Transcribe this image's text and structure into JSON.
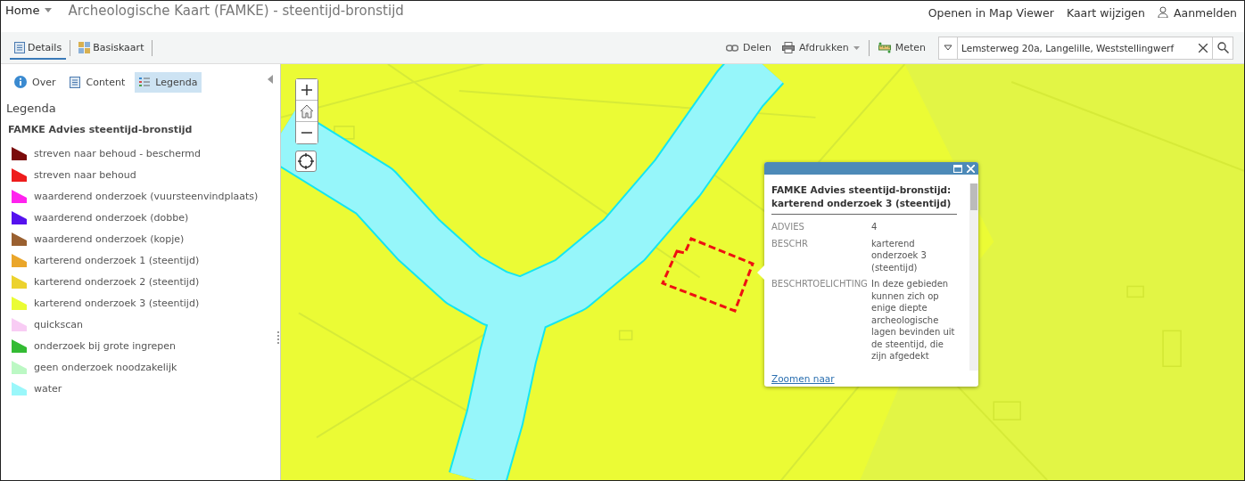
{
  "header": {
    "home": "Home",
    "title": "Archeologische Kaart (FAMKE) - steentijd-bronstijd",
    "links": [
      "Openen in Map Viewer",
      "Kaart wijzigen"
    ],
    "sign_in": "Aanmelden"
  },
  "toolbar": {
    "tabs": [
      {
        "label": "Details",
        "selected": true
      },
      {
        "label": "Basiskaart",
        "selected": false
      }
    ],
    "actions": [
      {
        "kind": "share",
        "label": "Delen"
      },
      {
        "kind": "print",
        "label": "Afdrukken"
      },
      {
        "kind": "measure",
        "label": "Meten"
      }
    ],
    "search": {
      "value": "Lemsterweg 20a, Langelille, Weststellingwerf"
    }
  },
  "panel": {
    "tabs": [
      {
        "kind": "info",
        "label": "Over",
        "selected": false
      },
      {
        "kind": "content",
        "label": "Content",
        "selected": false
      },
      {
        "kind": "legend",
        "label": "Legenda",
        "selected": true
      }
    ],
    "heading": "Legenda",
    "layer_title": "FAMKE Advies steentijd-bronstijd",
    "items": [
      {
        "label": "streven naar behoud - beschermd",
        "color": "#7a0a0a"
      },
      {
        "label": "streven naar behoud",
        "color": "#ee1c1c"
      },
      {
        "label": "waarderend onderzoek (vuursteenvindplaats)",
        "color": "#ff22ee"
      },
      {
        "label": "waarderend onderzoek (dobbe)",
        "color": "#5511ee"
      },
      {
        "label": "waarderend onderzoek (kopje)",
        "color": "#9a6030"
      },
      {
        "label": "karterend onderzoek 1 (steentijd)",
        "color": "#eaa62a"
      },
      {
        "label": "karterend onderzoek 2 (steentijd)",
        "color": "#ecd22e"
      },
      {
        "label": "karterend onderzoek 3 (steentijd)",
        "color": "#eafc34"
      },
      {
        "label": "quickscan",
        "color": "#f8ccf4"
      },
      {
        "label": "onderzoek bij grote ingrepen",
        "color": "#33bb33"
      },
      {
        "label": "geen onderzoek noodzakelijk",
        "color": "#bcf8c4"
      },
      {
        "label": "water",
        "color": "#9af7fa"
      }
    ]
  },
  "popup": {
    "title": "FAMKE Advies steentijd-bronstijd: karterend onderzoek 3 (steentijd)",
    "fields": [
      {
        "name": "ADVIES",
        "value": "4"
      },
      {
        "name": "BESCHR",
        "value": "karterend onderzoek 3 (steentijd)"
      },
      {
        "name": "BESCHRTOELICHTING",
        "value": "In deze gebieden kunnen zich op enige diepte archeologische lagen bevinden uit de steentijd, die zijn afgedekt"
      }
    ],
    "link": "Zoomen naar"
  }
}
